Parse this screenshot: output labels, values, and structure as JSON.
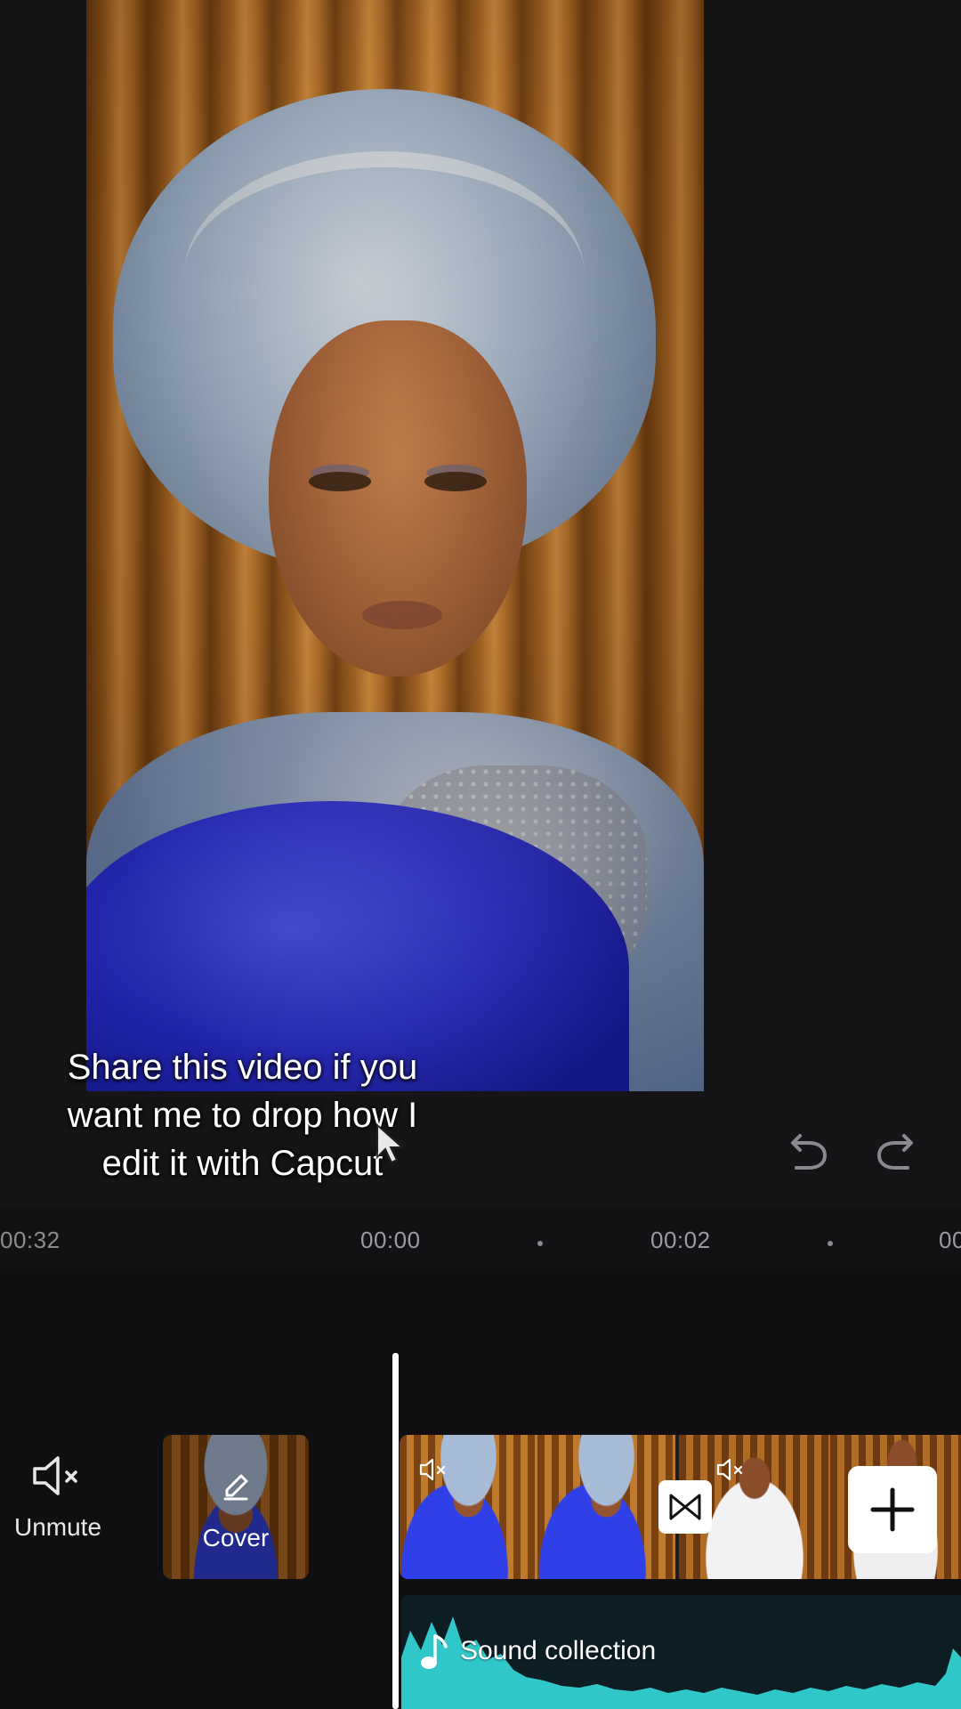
{
  "caption": {
    "text": "Share this video if you\nwant me to drop how I\nedit it with Capcut"
  },
  "toolbar": {
    "undo_icon": "undo-icon",
    "redo_icon": "redo-icon"
  },
  "timeline": {
    "total_duration": "00:32",
    "ticks": [
      "00:00",
      "00:02",
      "00"
    ]
  },
  "tracks": {
    "unmute_label": "Unmute",
    "cover_label": "Cover",
    "audio_label": "Sound collection",
    "transition_icon": "bowtie-transition-icon",
    "add_icon": "plus-icon"
  },
  "colors": {
    "background": "#141416",
    "audio_wave": "#2fc7c8",
    "playhead": "#ffffff"
  }
}
